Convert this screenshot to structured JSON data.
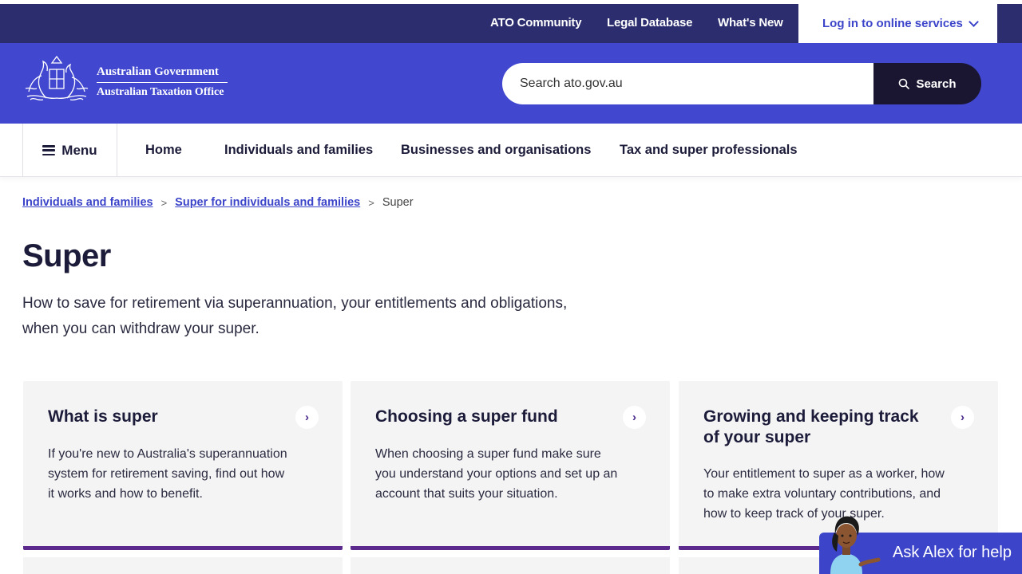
{
  "utility": {
    "links": [
      "ATO Community",
      "Legal Database",
      "What's New"
    ],
    "login_label": "Log in to online services"
  },
  "header": {
    "gov_line1": "Australian Government",
    "gov_line2": "Australian Taxation Office",
    "search_placeholder": "Search ato.gov.au",
    "search_button": "Search"
  },
  "nav": {
    "menu_label": "Menu",
    "items": [
      "Home",
      "Individuals and families",
      "Businesses and organisations",
      "Tax and super professionals"
    ]
  },
  "breadcrumb": {
    "items": [
      "Individuals and families",
      "Super for individuals and families"
    ],
    "current": "Super"
  },
  "page": {
    "title": "Super",
    "description": "How to save for retirement via superannuation, your entitlements and obligations, when you can withdraw your super."
  },
  "cards": [
    {
      "title": "What is super",
      "text_lines": [
        "If you're new to Australia's superannuation",
        "system for retirement saving, find out how",
        "it works and how to benefit."
      ]
    },
    {
      "title": "Choosing a super fund",
      "text_lines": [
        "When choosing a super fund make sure",
        "you understand your options and set up an",
        "account that suits your situation."
      ]
    },
    {
      "title_lines": [
        "Growing and keeping track",
        "of your super"
      ],
      "text_lines": [
        "Your entitlement to super as a worker, how",
        "to make extra voluntary contributions, and",
        "how to keep track of your super."
      ]
    }
  ],
  "alex": {
    "label": "Ask Alex for help"
  },
  "colors": {
    "utility_bar": "#2b2d6e",
    "header": "#4148cf",
    "accent": "#3c45c9",
    "card_border": "#5b2a8c"
  }
}
